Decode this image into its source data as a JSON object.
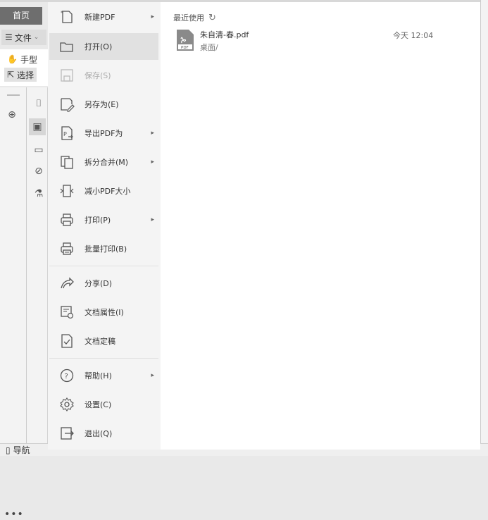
{
  "app": {
    "tab_home": "首页",
    "file_menu": "文件",
    "tool_hand": "手型",
    "tool_select": "选择",
    "nav_label": "导航",
    "more": "•••"
  },
  "menu": [
    {
      "label": "新建PDF",
      "icon": "new-pdf-icon",
      "arrow": true
    },
    {
      "label": "打开(O)",
      "icon": "open-folder-icon",
      "arrow": false,
      "hover": true
    },
    {
      "label": "保存(S)",
      "icon": "save-icon",
      "arrow": false,
      "disabled": true
    },
    {
      "label": "另存为(E)",
      "icon": "save-as-icon",
      "arrow": false
    },
    {
      "label": "导出PDF为",
      "icon": "export-pdf-icon",
      "arrow": true
    },
    {
      "label": "拆分合并(M)",
      "icon": "split-merge-icon",
      "arrow": true
    },
    {
      "label": "减小PDF大小",
      "icon": "compress-icon",
      "arrow": false
    },
    {
      "label": "打印(P)",
      "icon": "print-icon",
      "arrow": true
    },
    {
      "label": "批量打印(B)",
      "icon": "batch-print-icon",
      "arrow": false
    },
    {
      "label": "分享(D)",
      "icon": "share-icon",
      "arrow": false
    },
    {
      "label": "文档属性(I)",
      "icon": "doc-properties-icon",
      "arrow": false
    },
    {
      "label": "文档定稿",
      "icon": "finalize-icon",
      "arrow": false
    },
    {
      "label": "帮助(H)",
      "icon": "help-icon",
      "arrow": true
    },
    {
      "label": "设置(C)",
      "icon": "settings-icon",
      "arrow": false
    },
    {
      "label": "退出(Q)",
      "icon": "exit-icon",
      "arrow": false
    }
  ],
  "recent": {
    "title": "最近使用",
    "files": [
      {
        "name": "朱自清-春.pdf",
        "path": "桌面/",
        "time": "今天  12:04"
      }
    ]
  }
}
